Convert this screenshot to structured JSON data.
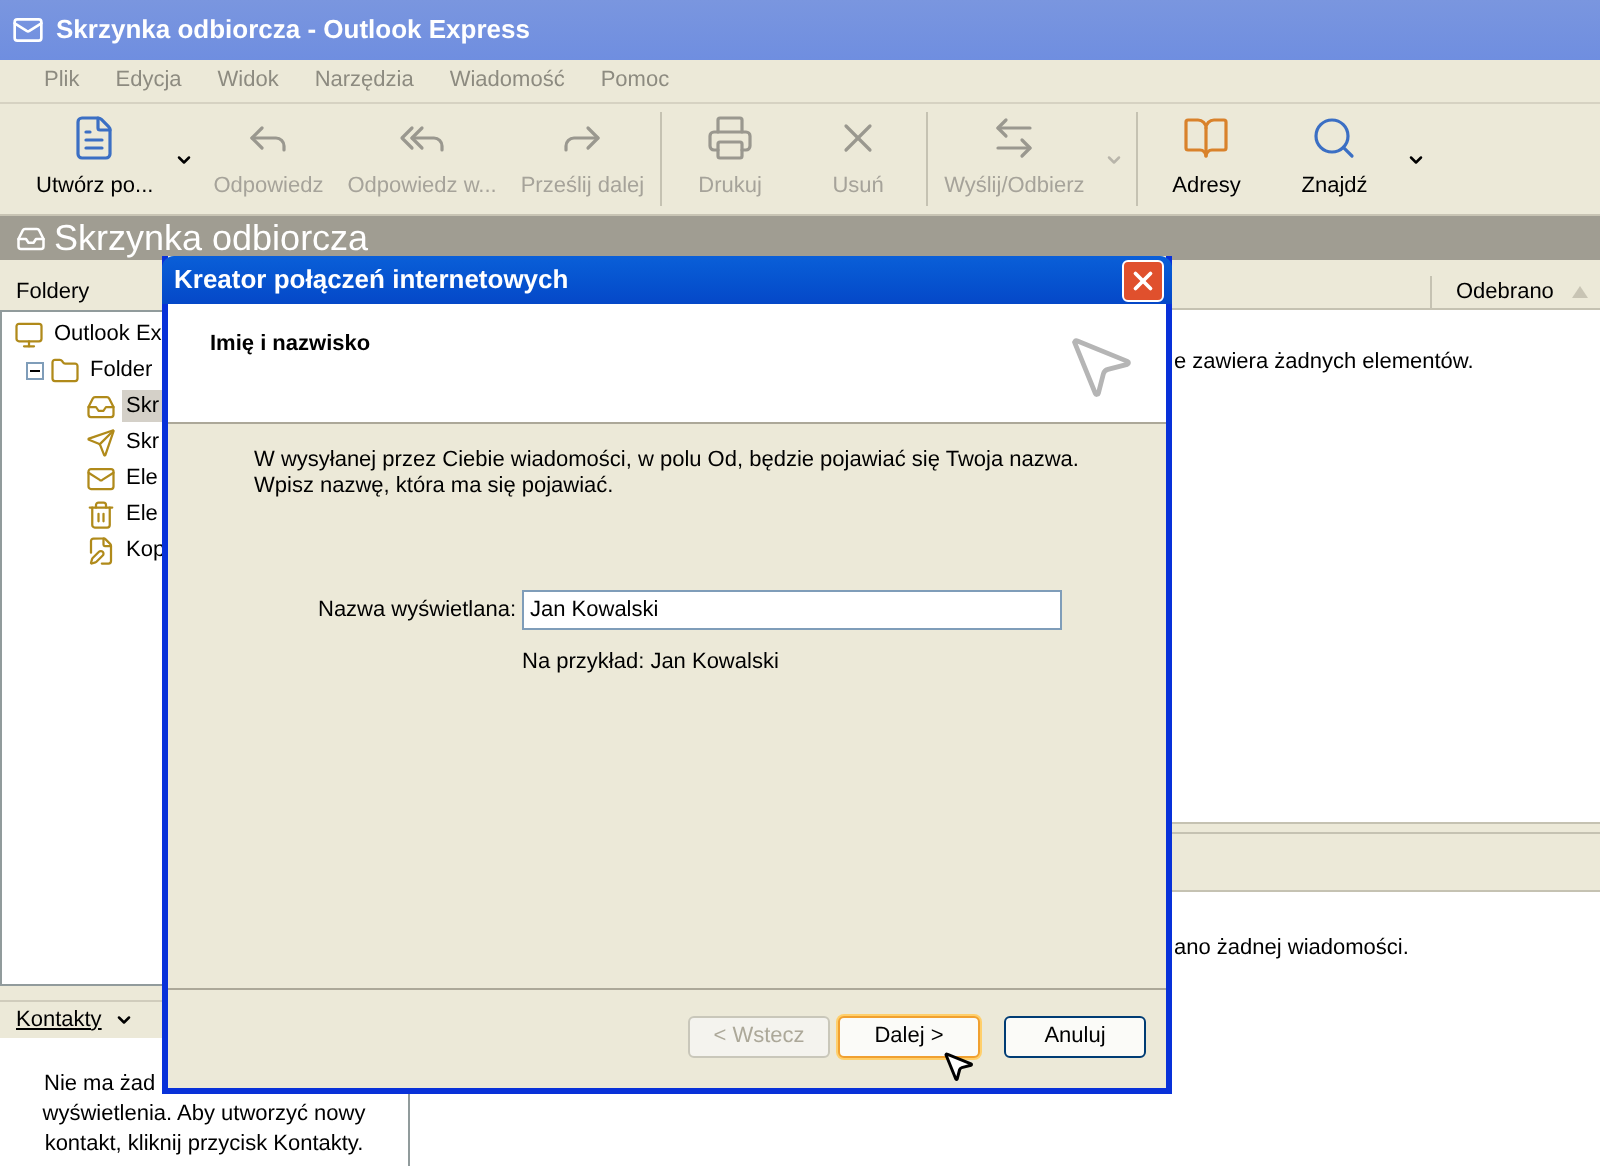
{
  "window": {
    "title": "Skrzynka odbiorcza - Outlook Express"
  },
  "menu": [
    "Plik",
    "Edycja",
    "Widok",
    "Narzędzia",
    "Wiadomość",
    "Pomoc"
  ],
  "toolbar": [
    {
      "label": "Utwórz po...",
      "kind": "new",
      "disabled": false,
      "dropdown": true
    },
    {
      "label": "Odpowiedz",
      "kind": "reply",
      "disabled": true,
      "dropdown": false
    },
    {
      "label": "Odpowiedz w...",
      "kind": "reply_all",
      "disabled": true,
      "dropdown": false
    },
    {
      "label": "Prześlij dalej",
      "kind": "forward",
      "disabled": true,
      "dropdown": false
    },
    {
      "label": "Drukuj",
      "kind": "print",
      "disabled": true,
      "dropdown": false
    },
    {
      "label": "Usuń",
      "kind": "delete",
      "disabled": true,
      "dropdown": false
    },
    {
      "label": "Wyślij/Odbierz",
      "kind": "send_receive",
      "disabled": true,
      "dropdown": true
    },
    {
      "label": "Adresy",
      "kind": "addresses",
      "disabled": false,
      "dropdown": false
    },
    {
      "label": "Znajdź",
      "kind": "find",
      "disabled": false,
      "dropdown": true
    }
  ],
  "folder_bar": {
    "title": "Skrzynka odbiorcza"
  },
  "folders_pane": {
    "title": "Foldery",
    "tree": [
      {
        "label": "Outlook Ex",
        "kind": "root",
        "selected": false,
        "children": [
          {
            "label": "Folder",
            "kind": "local",
            "selected": false,
            "expanded": true,
            "children": [
              {
                "label": "Skr",
                "kind": "inbox",
                "selected": true
              },
              {
                "label": "Skr",
                "kind": "outbox",
                "selected": false
              },
              {
                "label": "Ele",
                "kind": "sent",
                "selected": false
              },
              {
                "label": "Ele",
                "kind": "deleted",
                "selected": false
              },
              {
                "label": "Kop",
                "kind": "drafts",
                "selected": false
              }
            ]
          }
        ]
      }
    ]
  },
  "message_list": {
    "columns": [
      {
        "label": "Odebrano"
      }
    ],
    "empty_text": "e zawiera żadnych elementów."
  },
  "preview": {
    "empty_text": "ano żadnej wiadomości."
  },
  "contacts": {
    "title": "Kontakty",
    "lines": [
      "Nie ma żad",
      "wyświetlenia. Aby utworzyć nowy",
      "kontakt, kliknij przycisk Kontakty."
    ]
  },
  "dialog": {
    "title": "Kreator połączeń internetowych",
    "heading": "Imię i nazwisko",
    "description_lines": [
      "W wysyłanej przez Ciebie wiadomości, w polu Od, będzie pojawiać się Twoja nazwa.",
      "Wpisz nazwę, która ma się pojawiać."
    ],
    "field": {
      "label": "Nazwa wyświetlana:",
      "value": "Jan Kowalski",
      "hint": "Na przykład: Jan Kowalski"
    },
    "buttons": [
      {
        "label": "< Wstecz",
        "disabled": true,
        "focused": false
      },
      {
        "label": "Dalej >",
        "disabled": false,
        "focused": true
      },
      {
        "label": "Anuluj",
        "disabled": false,
        "focused": false
      }
    ]
  }
}
